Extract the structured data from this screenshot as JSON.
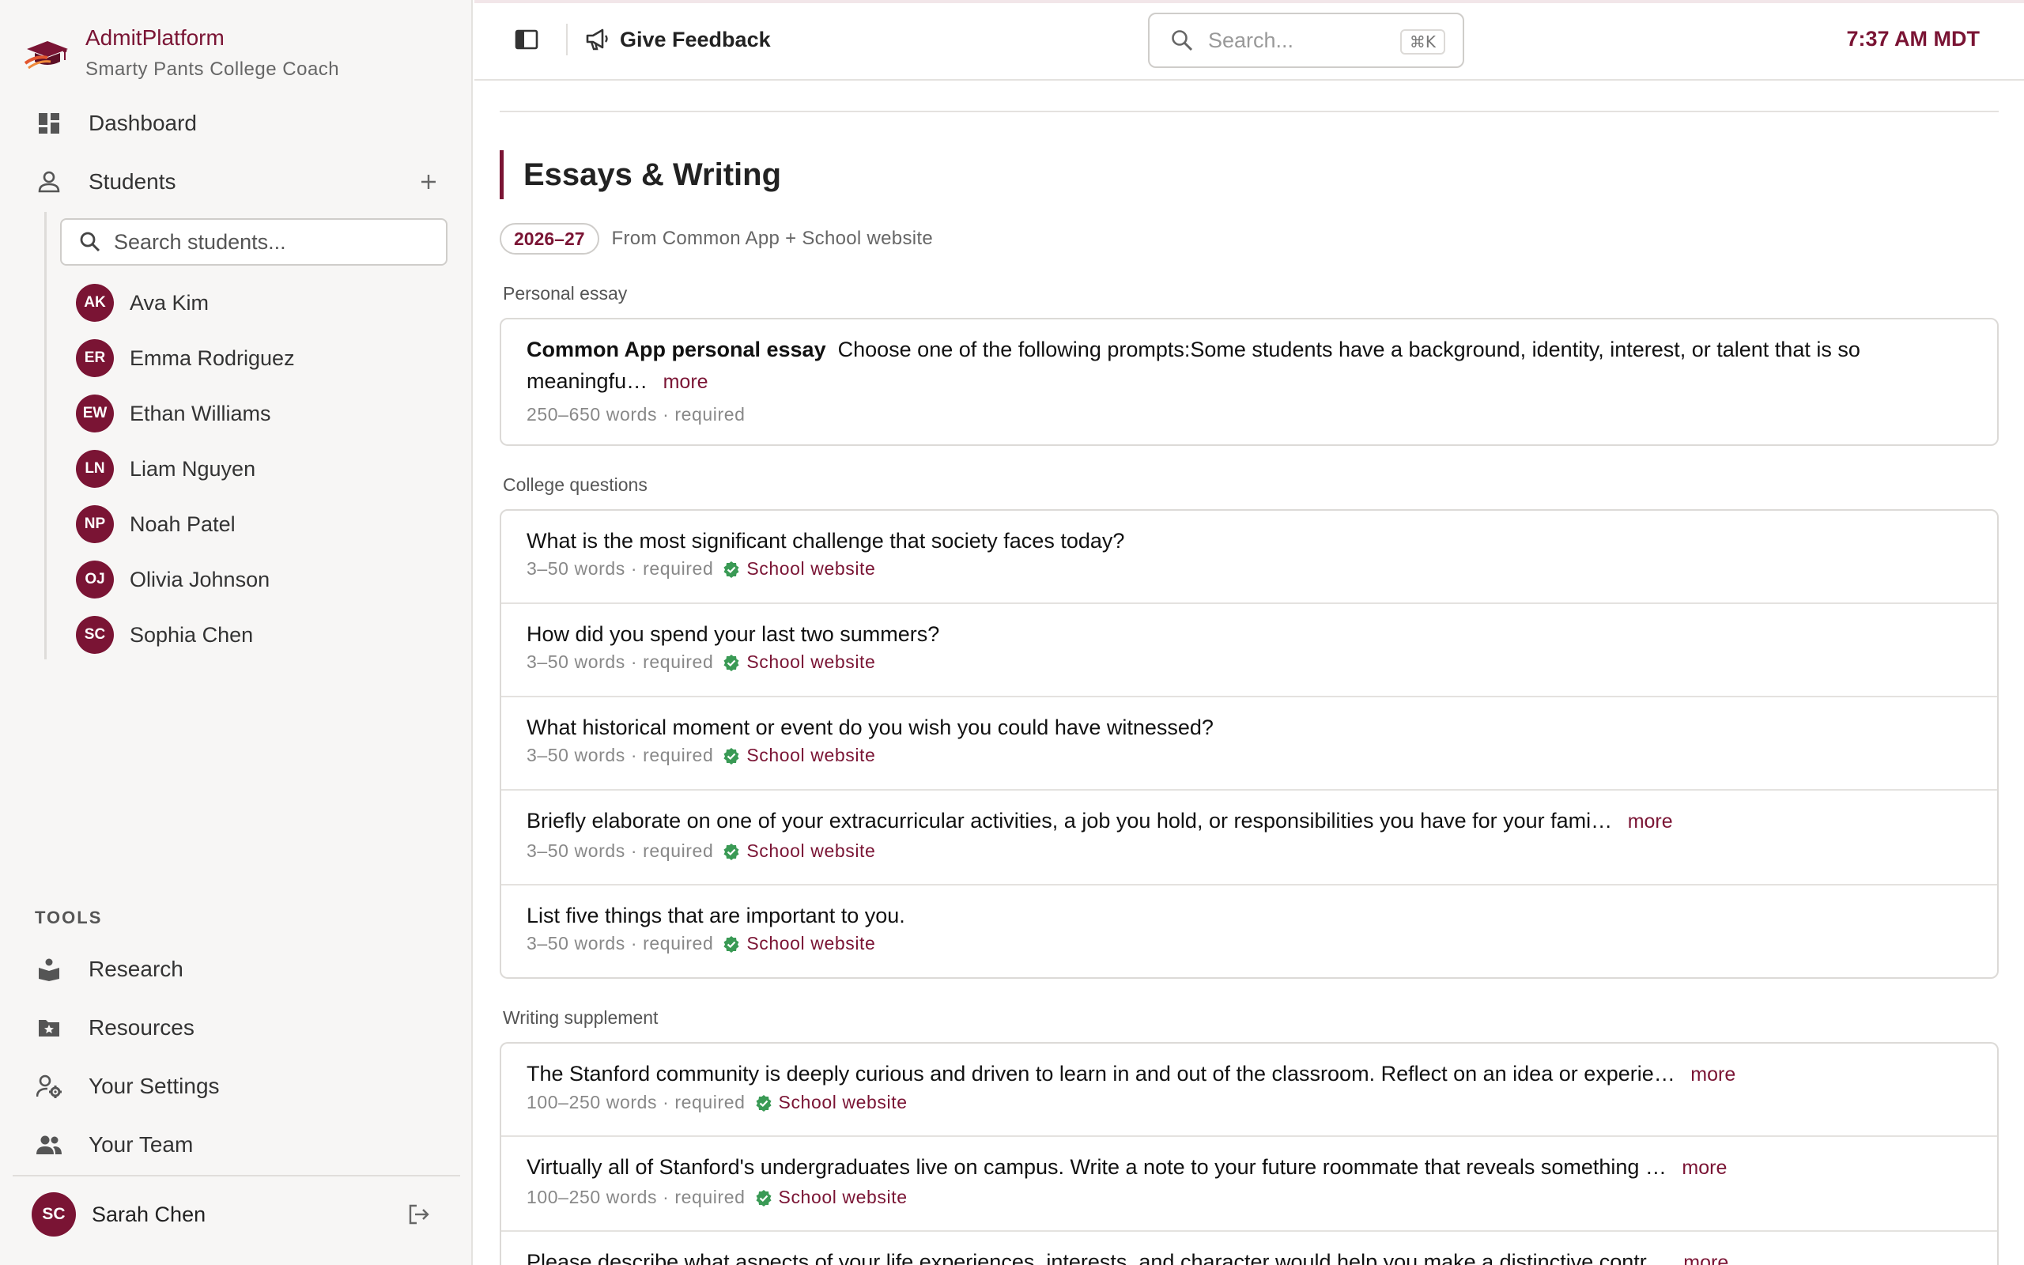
{
  "brand": {
    "name": "AdmitPlatform",
    "subtitle": "Smarty Pants College Coach"
  },
  "nav": {
    "dashboard": "Dashboard",
    "students": "Students",
    "student_search_placeholder": "Search students...",
    "students_list": [
      {
        "initials": "AK",
        "name": "Ava Kim"
      },
      {
        "initials": "ER",
        "name": "Emma Rodriguez"
      },
      {
        "initials": "EW",
        "name": "Ethan Williams"
      },
      {
        "initials": "LN",
        "name": "Liam Nguyen"
      },
      {
        "initials": "NP",
        "name": "Noah Patel"
      },
      {
        "initials": "OJ",
        "name": "Olivia Johnson"
      },
      {
        "initials": "SC",
        "name": "Sophia Chen"
      }
    ],
    "tools_heading": "TOOLS",
    "research": "Research",
    "resources": "Resources",
    "settings": "Your Settings",
    "team": "Your Team"
  },
  "user": {
    "initials": "SC",
    "name": "Sarah Chen"
  },
  "topbar": {
    "feedback": "Give Feedback",
    "search_placeholder": "Search...",
    "shortcut": "⌘K",
    "time": "7:37 AM MDT"
  },
  "main": {
    "title": "Essays & Writing",
    "year": "2026–27",
    "source": "From Common App + School website",
    "personal_label": "Personal essay",
    "personal": {
      "title": "Common App personal essay",
      "text": "Choose one of the following prompts:Some students have a background, identity, interest, or talent that is so meaningfu…",
      "more": "more",
      "meta": "250–650 words · required"
    },
    "college_label": "College questions",
    "college": [
      {
        "text": "What is the most significant challenge that society faces today?",
        "meta": "3–50 words · required",
        "source": "School website"
      },
      {
        "text": "How did you spend your last two summers?",
        "meta": "3–50 words · required",
        "source": "School website"
      },
      {
        "text": "What historical moment or event do you wish you could have witnessed?",
        "meta": "3–50 words · required",
        "source": "School website"
      },
      {
        "text": "Briefly elaborate on one of your extracurricular activities, a job you hold, or responsibilities you have for your fami…",
        "more": "more",
        "meta": "3–50 words · required",
        "source": "School website"
      },
      {
        "text": "List five things that are important to you.",
        "meta": "3–50 words · required",
        "source": "School website"
      }
    ],
    "supplement_label": "Writing supplement",
    "supplement": [
      {
        "text": "The Stanford community is deeply curious and driven to learn in and out of the classroom. Reflect on an idea or experie…",
        "more": "more",
        "meta": "100–250 words · required",
        "source": "School website"
      },
      {
        "text": "Virtually all of Stanford's undergraduates live on campus. Write a note to your future roommate that reveals something …",
        "more": "more",
        "meta": "100–250 words · required",
        "source": "School website"
      },
      {
        "text": "Please describe what aspects of your life experiences, interests, and character would help you make a distinctive contr…",
        "more": "more"
      }
    ]
  },
  "colors": {
    "accent": "#7a1434",
    "verified": "#3a9a55"
  }
}
